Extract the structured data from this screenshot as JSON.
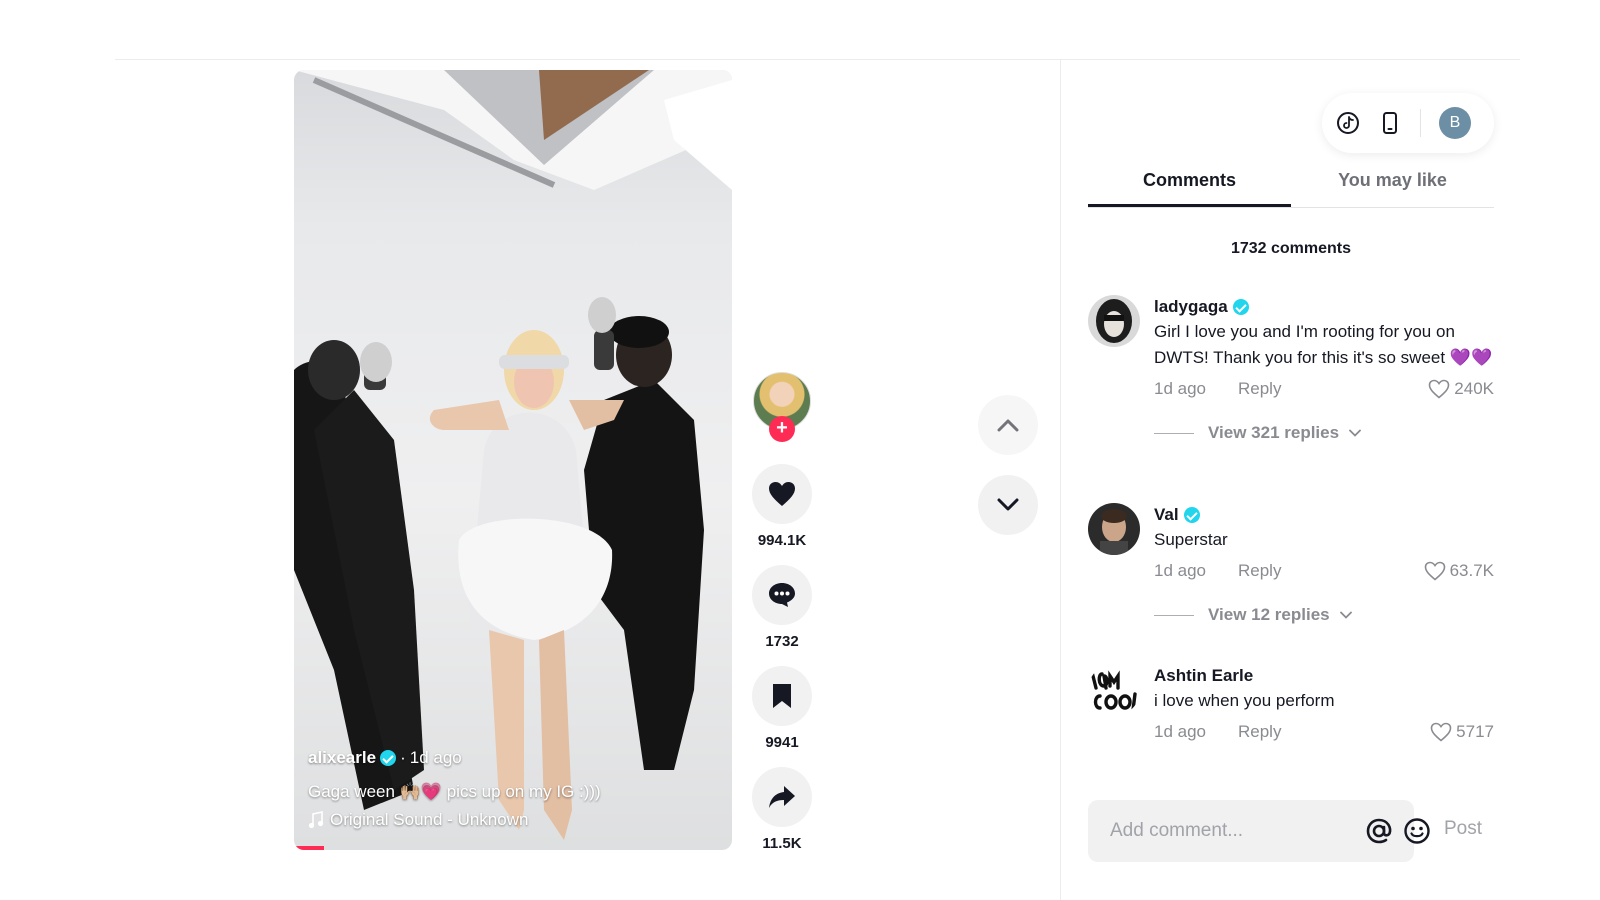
{
  "video": {
    "author": "alixearle",
    "posted": "1d ago",
    "separator": "·",
    "caption": "Gaga ween 🙌🏼💗 pics up on my IG :)))",
    "music": "Original Sound - Unknown",
    "more_label": "•••"
  },
  "actions": {
    "follow_label": "+",
    "likes": "994.1K",
    "comments": "1732",
    "saves": "9941",
    "shares": "11.5K"
  },
  "toolbar": {
    "user_initial": "B"
  },
  "panel": {
    "tabs": [
      {
        "label": "Comments",
        "active": true
      },
      {
        "label": "You may like",
        "active": false
      }
    ],
    "comment_count": "1732 comments"
  },
  "comments": [
    {
      "user": "ladygaga",
      "verified": true,
      "text": "Girl I love you and I'm rooting for you on DWTS! Thank you for this it's so sweet 💜💜",
      "time": "1d ago",
      "reply": "Reply",
      "likes": "240K",
      "replies": "View 321 replies"
    },
    {
      "user": "Val",
      "verified": true,
      "text": "Superstar",
      "time": "1d ago",
      "reply": "Reply",
      "likes": "63.7K",
      "replies": "View 12 replies"
    },
    {
      "user": "Ashtin Earle",
      "verified": false,
      "text": "i love when you perform",
      "time": "1d ago",
      "reply": "Reply",
      "likes": "5717"
    }
  ],
  "composer": {
    "placeholder": "Add comment...",
    "post_label": "Post"
  },
  "colors": {
    "accent": "#fe2c55",
    "verified": "#20d5ec",
    "muted": "#8a8b91"
  }
}
